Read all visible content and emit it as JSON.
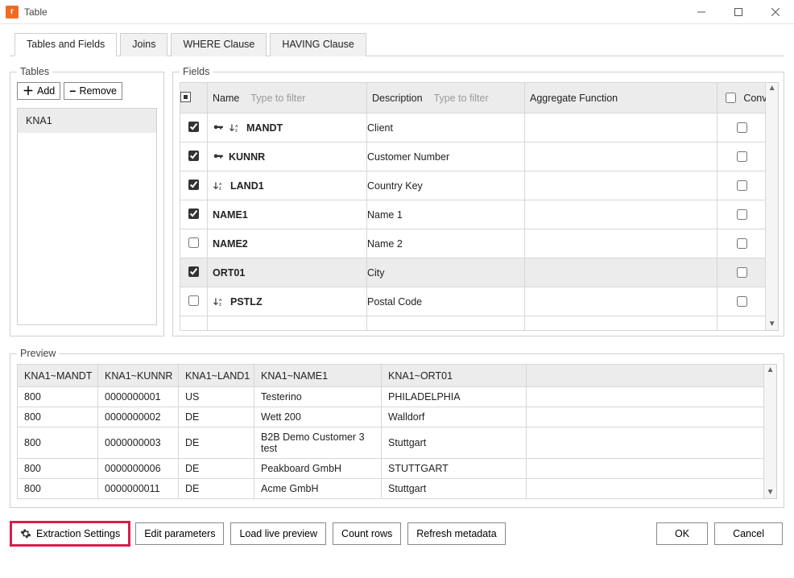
{
  "window": {
    "title": "Table"
  },
  "tabs": [
    {
      "label": "Tables and Fields",
      "active": true
    },
    {
      "label": "Joins"
    },
    {
      "label": "WHERE Clause"
    },
    {
      "label": "HAVING Clause"
    }
  ],
  "tables_panel": {
    "legend": "Tables",
    "add_label": "Add",
    "remove_label": "Remove",
    "items": [
      "KNA1"
    ]
  },
  "fields_panel": {
    "legend": "Fields",
    "headers": {
      "name": "Name",
      "name_placeholder": "Type to filter",
      "description": "Description",
      "description_placeholder": "Type to filter",
      "aggregate": "Aggregate Function",
      "conv": "Conv."
    },
    "rows": [
      {
        "checked": true,
        "key": true,
        "sort": true,
        "name": "MANDT",
        "desc": "Client",
        "conv_state": "dim"
      },
      {
        "checked": true,
        "key": true,
        "sort": false,
        "name": "KUNNR",
        "desc": "Customer Number",
        "conv_state": "open"
      },
      {
        "checked": true,
        "key": false,
        "sort": true,
        "name": "LAND1",
        "desc": "Country Key",
        "conv_state": "dim"
      },
      {
        "checked": true,
        "key": false,
        "sort": false,
        "name": "NAME1",
        "desc": "Name 1",
        "conv_state": "dim"
      },
      {
        "checked": false,
        "key": false,
        "sort": false,
        "name": "NAME2",
        "desc": "Name 2",
        "conv_state": "dim"
      },
      {
        "checked": true,
        "key": false,
        "sort": false,
        "name": "ORT01",
        "desc": "City",
        "conv_state": "dim",
        "shade": true
      },
      {
        "checked": false,
        "key": false,
        "sort": true,
        "name": "PSTLZ",
        "desc": "Postal Code",
        "conv_state": "dim"
      }
    ]
  },
  "preview": {
    "legend": "Preview",
    "columns": [
      "KNA1~MANDT",
      "KNA1~KUNNR",
      "KNA1~LAND1",
      "KNA1~NAME1",
      "KNA1~ORT01",
      ""
    ],
    "rows": [
      [
        "800",
        "0000000001",
        "US",
        "Testerino",
        "PHILADELPHIA",
        ""
      ],
      [
        "800",
        "0000000002",
        "DE",
        "Wett 200",
        "Walldorf",
        ""
      ],
      [
        "800",
        "0000000003",
        "DE",
        "B2B Demo Customer 3 test",
        "Stuttgart",
        ""
      ],
      [
        "800",
        "0000000006",
        "DE",
        "Peakboard GmbH",
        "STUTTGART",
        ""
      ],
      [
        "800",
        "0000000011",
        "DE",
        "Acme GmbH",
        "Stuttgart",
        ""
      ]
    ]
  },
  "footer": {
    "extraction_settings": "Extraction Settings",
    "edit_parameters": "Edit parameters",
    "load_live_preview": "Load live preview",
    "count_rows": "Count rows",
    "refresh_metadata": "Refresh metadata",
    "ok": "OK",
    "cancel": "Cancel"
  }
}
